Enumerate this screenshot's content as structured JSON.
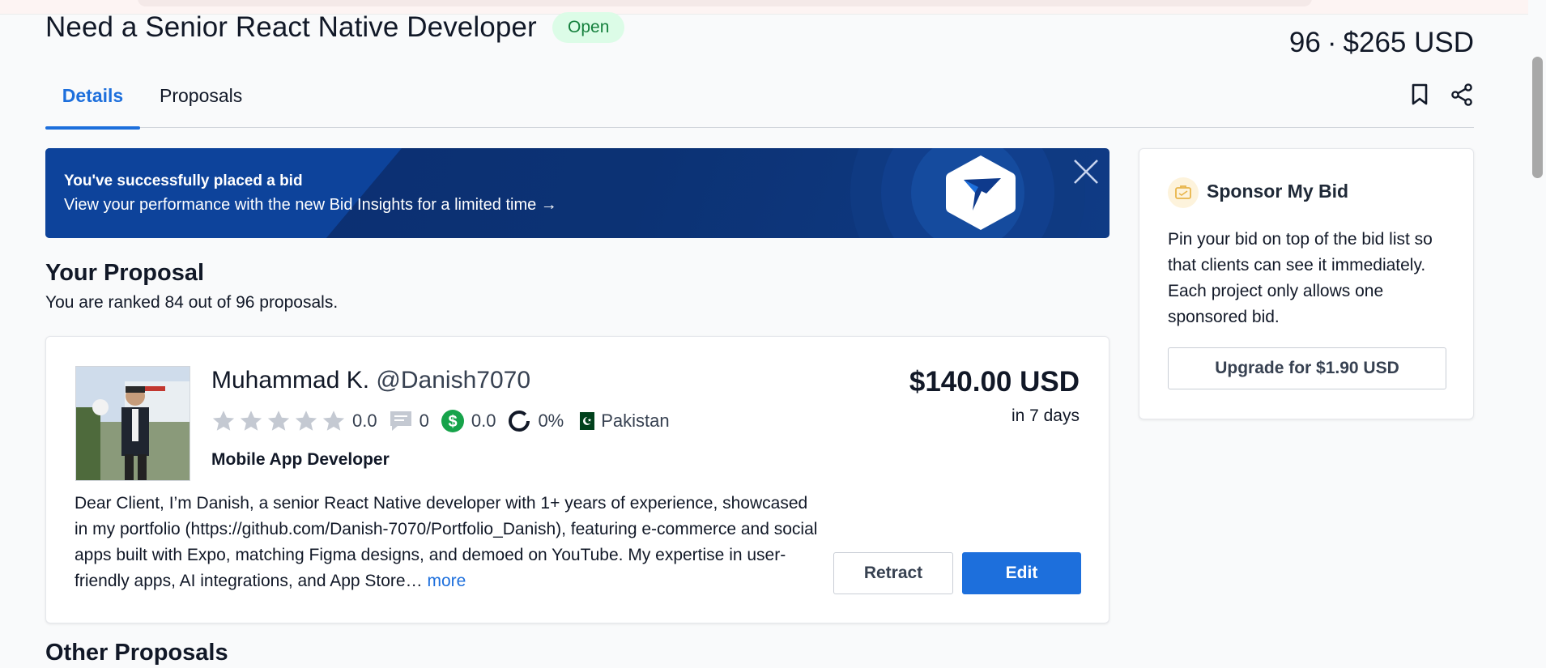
{
  "project": {
    "title": "Need a Senior React Native Developer",
    "status": "Open",
    "bid_count": "96",
    "separator": "·",
    "avg_bid": "$265 USD"
  },
  "tabs": [
    {
      "label": "Details",
      "active": true
    },
    {
      "label": "Proposals",
      "active": false
    }
  ],
  "tab_icons": [
    "bookmark-icon",
    "share-icon"
  ],
  "banner": {
    "line1": "You've successfully placed a bid",
    "line2": "View your performance with the new Bid Insights for a limited time →"
  },
  "proposal": {
    "section_title": "Your Proposal",
    "rank_text": "You are ranked 84 out of 96 proposals.",
    "name": "Muhammad K.",
    "handle": "@Danish7070",
    "stars_filled": 0,
    "rating": "0.0",
    "reviews": "0",
    "earnings_score": "0.0",
    "completion": "0%",
    "country": "Pakistan",
    "role": "Mobile App Developer",
    "description": "Dear Client, I’m Danish, a senior React Native developer with 1+ years of experience, showcased in my portfolio (https://github.com/Danish-7070/Portfolio_Danish), featuring e-commerce and social apps built with Expo, matching Figma designs, and demoed on YouTube. My expertise in user-friendly apps, AI integrations, and App Store…",
    "more_label": "more",
    "price": "$140.00 USD",
    "delivery": "in 7 days",
    "retract_label": "Retract",
    "edit_label": "Edit"
  },
  "other_proposals_title": "Other Proposals",
  "sponsor": {
    "title": "Sponsor My Bid",
    "text": "Pin your bid on top of the bid list so that clients can see it immediately. Each project only allows one sponsored bid.",
    "button_label": "Upgrade for $1.90 USD"
  },
  "colors": {
    "accent": "#1d6fdc",
    "banner_bg": "#0c2e71",
    "open_badge_bg": "#dcfce7",
    "open_badge_text": "#15803d"
  }
}
